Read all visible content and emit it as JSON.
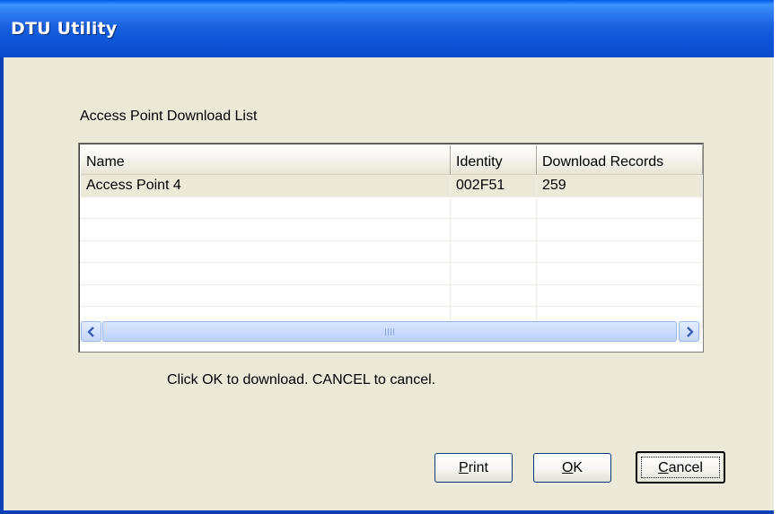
{
  "window": {
    "title": "DTU Utility"
  },
  "dialog": {
    "list_label": "Access Point Download List",
    "instruction": "Click OK to download. CANCEL to cancel."
  },
  "listview": {
    "columns": [
      "Name",
      "Identity",
      "Download Records"
    ],
    "rows": [
      [
        "Access Point 4",
        "002F51",
        "259"
      ]
    ],
    "selected_row": 0
  },
  "buttons": {
    "print": {
      "label_first": "P",
      "label_rest": "rint"
    },
    "ok": {
      "label_first": "O",
      "label_rest": "K"
    },
    "cancel": {
      "label_first": "C",
      "label_rest": "ancel"
    }
  },
  "colors": {
    "titlebar": "#0b4bcc",
    "dialog_bg": "#ece9d8",
    "scroll_accent": "#c3d6fd"
  },
  "icons": {
    "scroll_left": "chevron-left-icon",
    "scroll_right": "chevron-right-icon",
    "scroll_grip": "grip-icon"
  }
}
